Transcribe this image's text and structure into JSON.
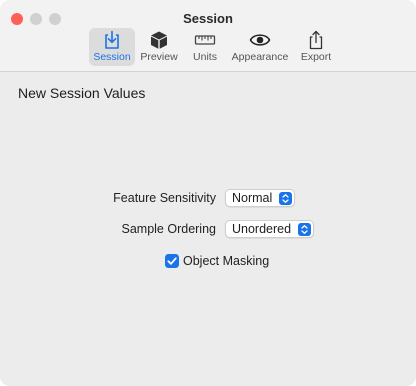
{
  "window": {
    "title": "Session"
  },
  "toolbar": {
    "items": [
      {
        "label": "Session",
        "icon": "session-download-icon",
        "selected": true
      },
      {
        "label": "Preview",
        "icon": "cube-icon",
        "selected": false
      },
      {
        "label": "Units",
        "icon": "ruler-icon",
        "selected": false
      },
      {
        "label": "Appearance",
        "icon": "eye-icon",
        "selected": false
      },
      {
        "label": "Export",
        "icon": "share-export-icon",
        "selected": false
      }
    ]
  },
  "main": {
    "section_title": "New Session Values",
    "feature_sensitivity": {
      "label": "Feature Sensitivity",
      "value": "Normal"
    },
    "sample_ordering": {
      "label": "Sample Ordering",
      "value": "Unordered"
    },
    "object_masking": {
      "label": "Object Masking",
      "checked": true
    }
  },
  "colors": {
    "accent": "#1a73e8",
    "close_button": "#ff5f57",
    "inactive_traffic": "#d0d0d0",
    "window_background": "#ececec"
  }
}
